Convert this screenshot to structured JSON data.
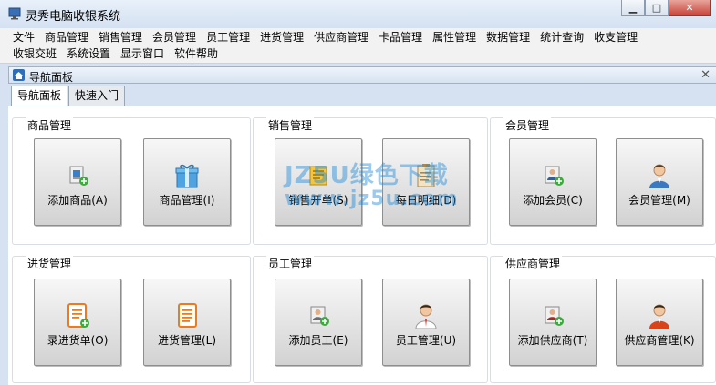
{
  "window": {
    "title": "灵秀电脑收银系统",
    "minimize_symbol": "▁",
    "maximize_symbol": "□",
    "close_symbol": "✕"
  },
  "menu": {
    "row1": [
      "文件",
      "商品管理",
      "销售管理",
      "会员管理",
      "员工管理",
      "进货管理",
      "供应商管理",
      "卡品管理",
      "属性管理",
      "数据管理",
      "统计查询",
      "收支管理"
    ],
    "row2": [
      "收银交班",
      "系统设置",
      "显示窗口",
      "软件帮助"
    ]
  },
  "panel": {
    "title": "导航面板",
    "close_symbol": "✕",
    "tabs": [
      "导航面板",
      "快速入门"
    ]
  },
  "groups": {
    "goods": {
      "title": "商品管理",
      "tiles": [
        {
          "label": "添加商品(A)",
          "icon": "add-product-icon"
        },
        {
          "label": "商品管理(I)",
          "icon": "gift-box-icon"
        }
      ]
    },
    "sales": {
      "title": "销售管理",
      "tiles": [
        {
          "label": "销售开单(S)",
          "icon": "sales-ticket-icon"
        },
        {
          "label": "每日明细(D)",
          "icon": "clipboard-icon"
        }
      ]
    },
    "members": {
      "title": "会员管理",
      "tiles": [
        {
          "label": "添加会员(C)",
          "icon": "add-member-icon"
        },
        {
          "label": "会员管理(M)",
          "icon": "member-person-icon"
        }
      ]
    },
    "purchase": {
      "title": "进货管理",
      "tiles": [
        {
          "label": "录进货单(O)",
          "icon": "add-purchase-doc-icon"
        },
        {
          "label": "进货管理(L)",
          "icon": "purchase-doc-icon"
        }
      ]
    },
    "staff": {
      "title": "员工管理",
      "tiles": [
        {
          "label": "添加员工(E)",
          "icon": "add-staff-icon"
        },
        {
          "label": "员工管理(U)",
          "icon": "staff-person-icon"
        }
      ]
    },
    "suppliers": {
      "title": "供应商管理",
      "tiles": [
        {
          "label": "添加供应商(T)",
          "icon": "add-supplier-icon"
        },
        {
          "label": "供应商管理(K)",
          "icon": "supplier-person-icon"
        }
      ]
    }
  },
  "watermark": {
    "line1": "JZ5U绿色下载",
    "line2": "www.jz5u.com"
  }
}
